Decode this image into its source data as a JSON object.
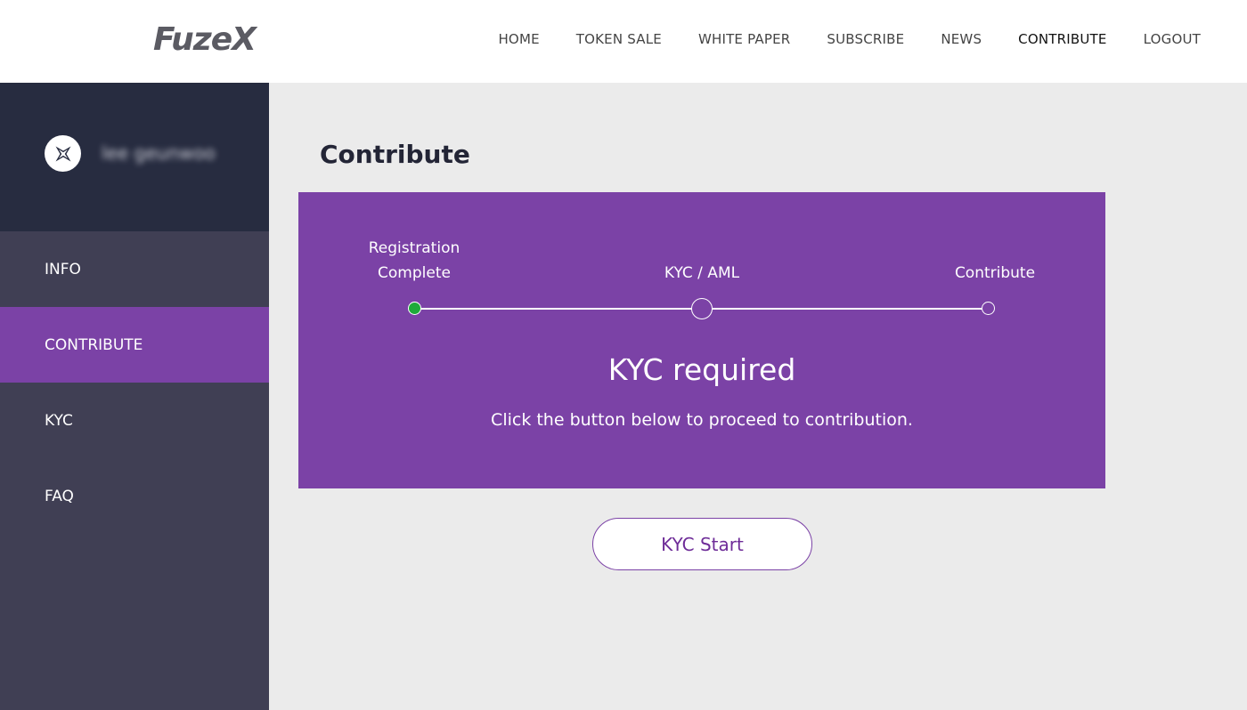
{
  "header": {
    "logo": "FuzeX",
    "nav": [
      {
        "label": "HOME",
        "active": false
      },
      {
        "label": "TOKEN SALE",
        "active": false
      },
      {
        "label": "WHITE PAPER",
        "active": false
      },
      {
        "label": "SUBSCRIBE",
        "active": false
      },
      {
        "label": "NEWS",
        "active": false
      },
      {
        "label": "CONTRIBUTE",
        "active": true
      },
      {
        "label": "LOGOUT",
        "active": false
      }
    ]
  },
  "sidebar": {
    "avatar_icon": "fuzex-logo-icon",
    "username": "lee geunwoo",
    "items": [
      {
        "label": "INFO",
        "active": false
      },
      {
        "label": "CONTRIBUTE",
        "active": true
      },
      {
        "label": "KYC",
        "active": false
      },
      {
        "label": "FAQ",
        "active": false
      }
    ]
  },
  "main": {
    "title": "Contribute",
    "steps": [
      {
        "label_line1": "Registration",
        "label_line2": "Complete",
        "state": "done"
      },
      {
        "label_line1": "KYC / AML",
        "state": "current"
      },
      {
        "label_line1": "Contribute",
        "state": "pending"
      }
    ],
    "heading": "KYC required",
    "subtext": "Click the button below to proceed to contribution.",
    "button_label": "KYC Start"
  },
  "colors": {
    "accent": "#7b42a6",
    "sidebar_bg": "#403f54",
    "sidebar_top": "#272c40",
    "done_dot": "#1eaa3a",
    "page_bg": "#ebebeb"
  }
}
